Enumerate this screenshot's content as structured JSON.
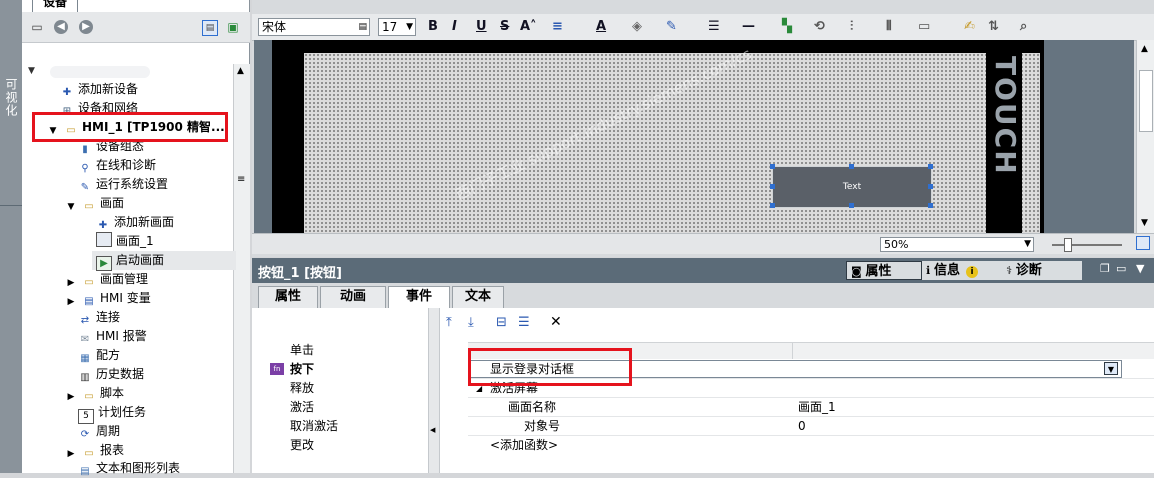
{
  "sidebar_strip": {
    "label": "可视化"
  },
  "device_panel": {
    "tab_label": "设备",
    "tree": [
      {
        "label": "添加新设备"
      },
      {
        "label": "设备和网络"
      },
      {
        "label": "HMI_1 [TP1900 精智..."
      },
      {
        "label": "设备组态"
      },
      {
        "label": "在线和诊断"
      },
      {
        "label": "运行系统设置"
      },
      {
        "label": "画面"
      },
      {
        "label": "添加新画面"
      },
      {
        "label": "画面_1"
      },
      {
        "label": "启动画面"
      },
      {
        "label": "画面管理"
      },
      {
        "label": "HMI 变量"
      },
      {
        "label": "连接"
      },
      {
        "label": "HMI 报警"
      },
      {
        "label": "配方"
      },
      {
        "label": "历史数据"
      },
      {
        "label": "脚本"
      },
      {
        "label": "计划任务"
      },
      {
        "label": "周期"
      },
      {
        "label": "报表"
      },
      {
        "label": "文本和图形列表"
      }
    ]
  },
  "format_toolbar": {
    "font_name": "宋体",
    "font_size": "17",
    "bold": "B",
    "italic": "I",
    "underline": "U",
    "strike": "S",
    "font_color": "A"
  },
  "canvas": {
    "device_brand": "TOUCH",
    "button_text": "Text",
    "watermark": "西门子工业 support.industry.siemens.com/cs",
    "zoom": "50%"
  },
  "inspector": {
    "title": "按钮_1 [按钮]",
    "header_tabs": {
      "properties": "属性",
      "info": "信息",
      "diagnostics": "诊断"
    },
    "tabs": [
      "属性",
      "动画",
      "事件",
      "文本"
    ],
    "events": [
      "单击",
      "按下",
      "释放",
      "激活",
      "取消激活",
      "更改"
    ],
    "functions": {
      "selected_function": "显示登录对话框",
      "group": "激活屏幕",
      "param1_name": "画面名称",
      "param1_value": "画面_1",
      "param2_name": "对象号",
      "param2_value": "0",
      "add_function": "<添加函数>"
    }
  },
  "colors": {
    "accent_red": "#e5131d",
    "header_gray": "#5b6b78",
    "selection_blue": "#2f6fd0"
  }
}
